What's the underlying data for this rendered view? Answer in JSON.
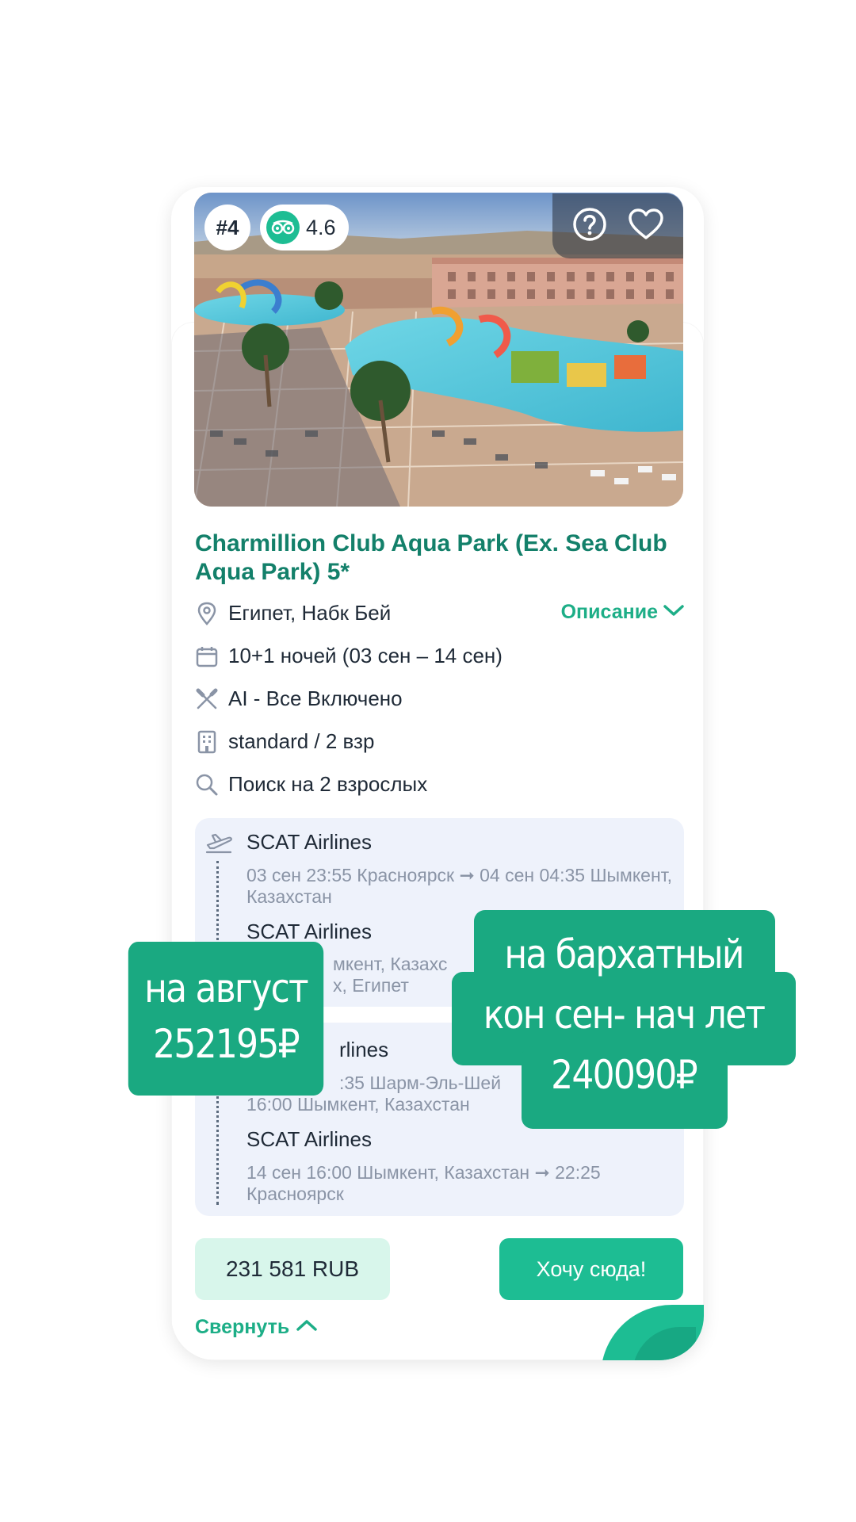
{
  "hotel": {
    "rank": "#4",
    "rating": "4.6",
    "name": "Charmillion Club Aqua Park (Ex. Sea Club Aqua Park) 5*",
    "location": "Египет, Набк Бей",
    "description_link": "Описание",
    "nights": "10+1 ночей (03 сен – 14 сен)",
    "meal": "AI - Все Включено",
    "room": "standard / 2 взр",
    "search": "Поиск на 2 взрослых"
  },
  "flights": {
    "outbound": [
      {
        "airline": "SCAT Airlines",
        "route": "03 сен 23:55 Красноярск ➞ 04 сен 04:35 Шымкент, Казахстан"
      },
      {
        "airline": "SCAT Airlines",
        "route_line1": "мкент, Казахс",
        "route_line2": "х, Египет"
      }
    ],
    "return": [
      {
        "airline": "rlines",
        "route_line1": ":35 Шарм-Эль-Шей",
        "route_line2": "16:00 Шымкент, Казахстан"
      },
      {
        "airline": "SCAT Airlines",
        "route": "14 сен 16:00 Шымкент, Казахстан ➞ 22:25 Красноярск"
      }
    ]
  },
  "footer": {
    "price": "231 581 RUB",
    "cta": "Хочу сюда!",
    "collapse": "Свернуть"
  },
  "overlay": {
    "august_line1": "на август",
    "august_line2": "252195₽",
    "velvet_line1": "на бархатный",
    "velvet_line2": "кон сен- нач лет",
    "velvet_line3": "240090₽"
  },
  "colors": {
    "accent": "#1dbd93",
    "title": "#13806a",
    "sticker": "#1aa981",
    "flight_bg": "#eef2fb"
  },
  "icons": [
    "tripadvisor-icon",
    "help-icon",
    "heart-icon",
    "location-pin-icon",
    "calendar-icon",
    "cutlery-icon",
    "building-icon",
    "search-icon",
    "plane-icon",
    "chevron-down-icon",
    "chevron-up-icon"
  ]
}
